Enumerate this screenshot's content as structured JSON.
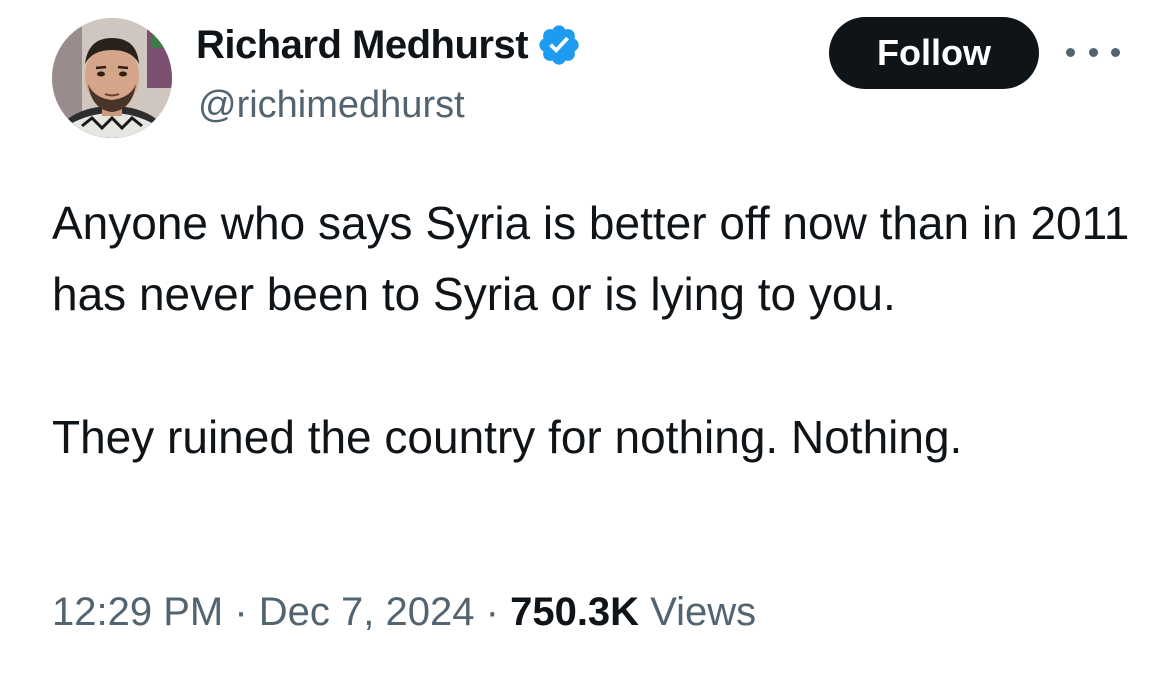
{
  "author": {
    "display_name": "Richard Medhurst",
    "handle": "@richimedhurst",
    "verified": true,
    "verified_color": "#1d9bf0"
  },
  "actions": {
    "follow_label": "Follow",
    "more_icon": "more-horizontal-icon"
  },
  "tweet": {
    "paragraph_1": "Anyone who says Syria is better off now than in 2011 has never been to Syria or is lying to you.",
    "paragraph_2": "They ruined the country for nothing. Nothing."
  },
  "meta": {
    "time": "12:29 PM",
    "separator": "·",
    "date": "Dec 7, 2024",
    "views_count": "750.3K",
    "views_label": "Views"
  }
}
